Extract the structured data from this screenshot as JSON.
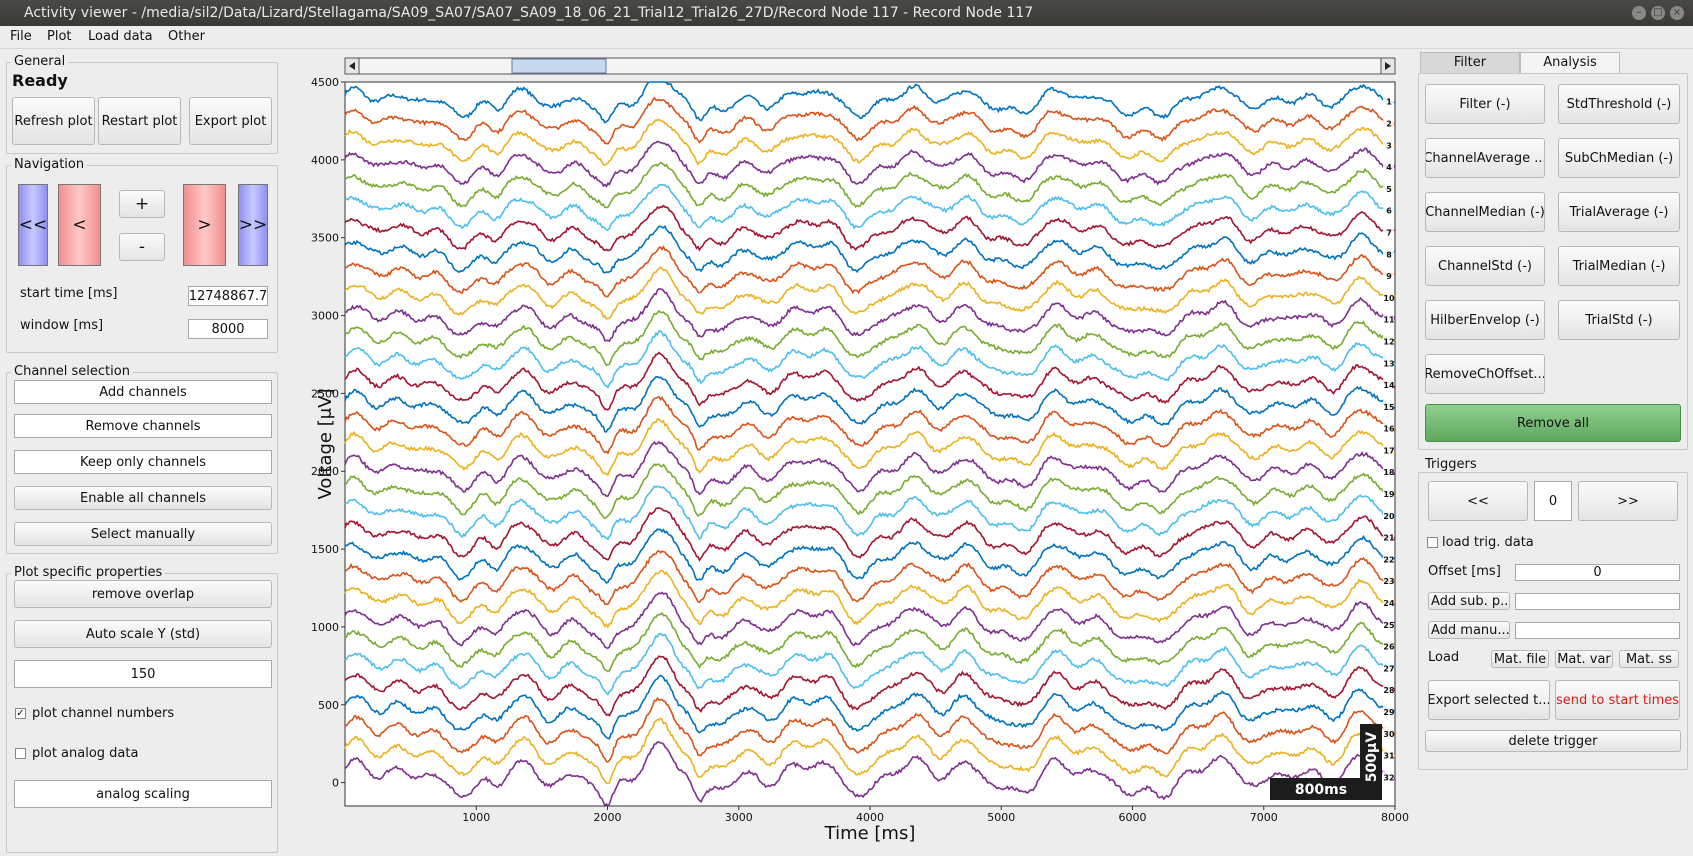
{
  "window": {
    "title": "Activity viewer - /media/sil2/Data/Lizard/Stellagama/SA09_SA07/SA07_SA09_18_06_21_Trial12_Trial26_27D/Record Node 117 - Record Node 117"
  },
  "menubar": {
    "items": [
      "File",
      "Plot",
      "Load data",
      "Other"
    ]
  },
  "general": {
    "title": "General",
    "status": "Ready",
    "refresh_label": "Refresh plot",
    "restart_label": "Restart plot",
    "export_label": "Export plot"
  },
  "navigation": {
    "title": "Navigation",
    "far_back": "<<",
    "back": "<",
    "zoom_in": "+",
    "zoom_out": "-",
    "forward": ">",
    "far_forward": ">>",
    "start_label": "start time [ms]",
    "start_value": "12748867.7",
    "window_label": "window [ms]",
    "window_value": "8000"
  },
  "channel_selection": {
    "title": "Channel selection",
    "add": "Add channels",
    "remove": "Remove channels",
    "keep": "Keep only channels",
    "enable_all": "Enable all channels",
    "select_manually": "Select manually"
  },
  "plot_props": {
    "title": "Plot specific properties",
    "remove_overlap": "remove overlap",
    "auto_scale": "Auto scale Y (std)",
    "scale_value": "150",
    "plot_channel_numbers": "plot channel numbers",
    "plot_channel_numbers_checked": true,
    "plot_analog": "plot analog data",
    "plot_analog_checked": false,
    "analog_scaling": "analog scaling"
  },
  "tabs": {
    "filter": "Filter",
    "analysis": "Analysis",
    "active": "Analysis"
  },
  "analysis_buttons": {
    "left": [
      "Filter (-)",
      "ChannelAverage ...",
      "ChannelMedian (-)",
      "ChannelStd (-)",
      "HilberEnvelop (-)",
      "RemoveChOffset..."
    ],
    "right": [
      "StdThreshold (-)",
      "SubChMedian (-)",
      "TrialAverage (-)",
      "TrialMedian (-)",
      "TrialStd (-)"
    ],
    "remove_all": "Remove all"
  },
  "triggers": {
    "title": "Triggers",
    "prev": "<<",
    "index": "0",
    "next": ">>",
    "load_trig": "load trig. data",
    "load_trig_checked": false,
    "offset_label": "Offset [ms]",
    "offset_value": "0",
    "add_sub": "Add sub. p...",
    "add_manual": "Add manu...",
    "load_label": "Load",
    "mat_file": "Mat. file",
    "mat_var": "Mat. var",
    "mat_ss": "Mat. ss",
    "export_selected": "Export selected t...",
    "send_to_start": "send to start times",
    "delete_trigger": "delete trigger",
    "send_color": "#e01818"
  },
  "chart_data": {
    "type": "line",
    "xlabel": "Time [ms]",
    "ylabel": "Voltage [μV]",
    "xlim": [
      0,
      8000
    ],
    "ylim": [
      -150,
      4500
    ],
    "xticks": [
      1000,
      2000,
      3000,
      4000,
      5000,
      6000,
      7000,
      8000
    ],
    "yticks": [
      0,
      500,
      1000,
      1500,
      2000,
      2500,
      3000,
      3500,
      4000,
      4500
    ],
    "channels": [
      "1",
      "2",
      "3",
      "4",
      "5",
      "6",
      "7",
      "8",
      "9",
      "10",
      "11",
      "12",
      "13",
      "14",
      "15",
      "16",
      "17",
      "18",
      "19",
      "20",
      "21",
      "22",
      "23",
      "24",
      "25",
      "26",
      "27",
      "28",
      "29",
      "30",
      "31",
      "32"
    ],
    "channel_offsets": [
      4380,
      4240,
      4100,
      3960,
      3820,
      3680,
      3540,
      3400,
      3260,
      3120,
      2980,
      2840,
      2700,
      2560,
      2420,
      2280,
      2140,
      2000,
      1860,
      1720,
      1580,
      1440,
      1300,
      1160,
      1020,
      880,
      740,
      600,
      460,
      320,
      180,
      40
    ],
    "colors": [
      "#0072bd",
      "#d95319",
      "#edb120",
      "#7e2f8e",
      "#77ac30",
      "#4dbeee",
      "#a2142f"
    ],
    "scale_bar_time": "800ms",
    "scale_bar_voltage": "500μV"
  }
}
